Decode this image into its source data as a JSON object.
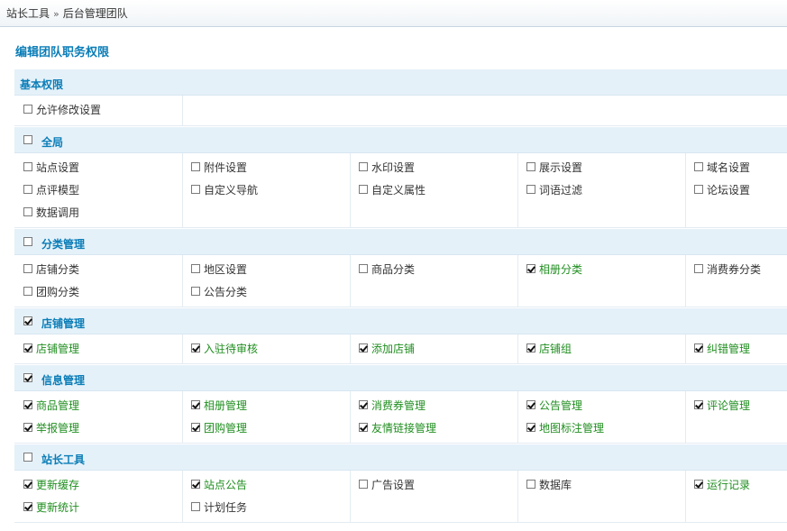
{
  "breadcrumb": {
    "root": "站长工具",
    "separator": "»",
    "current": "后台管理团队"
  },
  "page_title": "编辑团队职务权限",
  "basic": {
    "title": "基本权限",
    "items": [
      {
        "label": "允许修改设置",
        "checked": false
      }
    ]
  },
  "sections": [
    {
      "key": "global",
      "title": "全局",
      "checked": false,
      "items": [
        {
          "label": "站点设置",
          "checked": false
        },
        {
          "label": "附件设置",
          "checked": false
        },
        {
          "label": "水印设置",
          "checked": false
        },
        {
          "label": "展示设置",
          "checked": false
        },
        {
          "label": "域名设置",
          "checked": false
        },
        {
          "label": "点评模型",
          "checked": false
        },
        {
          "label": "自定义导航",
          "checked": false
        },
        {
          "label": "自定义属性",
          "checked": false
        },
        {
          "label": "词语过滤",
          "checked": false
        },
        {
          "label": "论坛设置",
          "checked": false
        },
        {
          "label": "数据调用",
          "checked": false
        }
      ]
    },
    {
      "key": "category",
      "title": "分类管理",
      "checked": false,
      "items": [
        {
          "label": "店铺分类",
          "checked": false
        },
        {
          "label": "地区设置",
          "checked": false
        },
        {
          "label": "商品分类",
          "checked": false
        },
        {
          "label": "相册分类",
          "checked": true
        },
        {
          "label": "消费券分类",
          "checked": false
        },
        {
          "label": "团购分类",
          "checked": false
        },
        {
          "label": "公告分类",
          "checked": false
        }
      ]
    },
    {
      "key": "shop",
      "title": "店铺管理",
      "checked": true,
      "items": [
        {
          "label": "店铺管理",
          "checked": true
        },
        {
          "label": "入驻待审核",
          "checked": true
        },
        {
          "label": "添加店铺",
          "checked": true
        },
        {
          "label": "店铺组",
          "checked": true
        },
        {
          "label": "纠错管理",
          "checked": true
        }
      ]
    },
    {
      "key": "info",
      "title": "信息管理",
      "checked": true,
      "items": [
        {
          "label": "商品管理",
          "checked": true
        },
        {
          "label": "相册管理",
          "checked": true
        },
        {
          "label": "消费券管理",
          "checked": true
        },
        {
          "label": "公告管理",
          "checked": true
        },
        {
          "label": "评论管理",
          "checked": true
        },
        {
          "label": "举报管理",
          "checked": true
        },
        {
          "label": "团购管理",
          "checked": true
        },
        {
          "label": "友情链接管理",
          "checked": true
        },
        {
          "label": "地图标注管理",
          "checked": true
        }
      ]
    },
    {
      "key": "tools",
      "title": "站长工具",
      "checked": false,
      "items": [
        {
          "label": "更新缓存",
          "checked": true
        },
        {
          "label": "站点公告",
          "checked": true
        },
        {
          "label": "广告设置",
          "checked": false
        },
        {
          "label": "数据库",
          "checked": false
        },
        {
          "label": "运行记录",
          "checked": true
        },
        {
          "label": "更新统计",
          "checked": true
        },
        {
          "label": "计划任务",
          "checked": false
        }
      ]
    }
  ]
}
